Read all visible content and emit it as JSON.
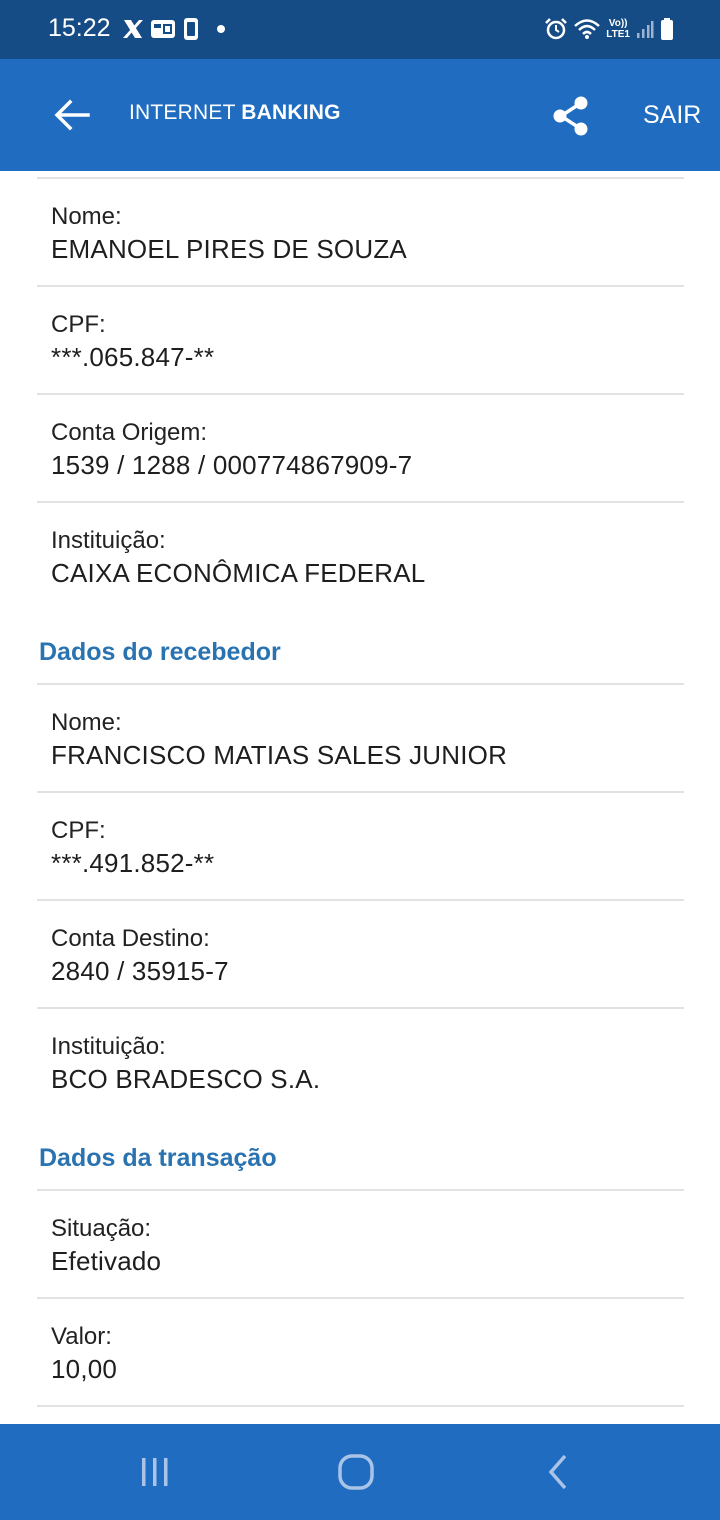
{
  "status_bar": {
    "time": "15:22",
    "left_icons": [
      "x-icon",
      "notification-icon",
      "sim-icon",
      "dot-icon"
    ],
    "right_icons": [
      "alarm-icon",
      "wifi-icon",
      "volte-icon",
      "signal-icon",
      "battery-icon"
    ],
    "volte_top": "Vo))",
    "volte_bottom": "LTE1"
  },
  "header": {
    "title_regular": "INTERNET ",
    "title_bold": "BANKING",
    "exit_label": "SAIR",
    "background_color": "#1f6cc0"
  },
  "payer": {
    "fields": [
      {
        "label": "Nome:",
        "value": "EMANOEL PIRES DE SOUZA"
      },
      {
        "label": "CPF:",
        "value": "***.065.847-**"
      },
      {
        "label": "Conta Origem:",
        "value": "1539 / 1288 / 000774867909-7"
      },
      {
        "label": "Instituição:",
        "value": "CAIXA ECONÔMICA FEDERAL"
      }
    ]
  },
  "receiver": {
    "title": "Dados do recebedor",
    "fields": [
      {
        "label": "Nome:",
        "value": "FRANCISCO MATIAS SALES JUNIOR"
      },
      {
        "label": "CPF:",
        "value": "***.491.852-**"
      },
      {
        "label": "Conta Destino:",
        "value": "2840 / 35915-7"
      },
      {
        "label": "Instituição:",
        "value": "BCO BRADESCO S.A."
      }
    ]
  },
  "transaction": {
    "title": "Dados da transação",
    "fields": [
      {
        "label": "Situação:",
        "value": "Efetivado"
      },
      {
        "label": "Valor:",
        "value": "10,00"
      }
    ]
  },
  "colors": {
    "status_bar": "#154c86",
    "app_bar": "#1f6cc0",
    "section_title": "#2a73b1",
    "divider": "#e2e2e2"
  },
  "nav_bar": {
    "buttons": [
      "recent-apps-icon",
      "home-icon",
      "back-icon"
    ]
  }
}
